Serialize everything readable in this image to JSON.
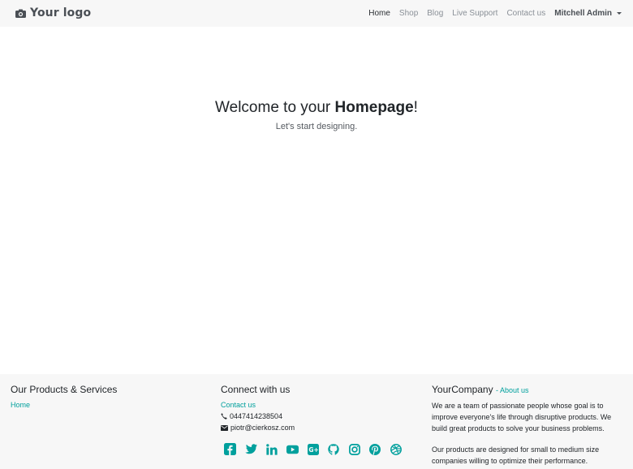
{
  "brand": {
    "logo_text": "Your logo",
    "icon": "camera-icon"
  },
  "nav": {
    "items": [
      "Home",
      "Shop",
      "Blog",
      "Live Support",
      "Contact us"
    ],
    "active": "Home",
    "user": "Mitchell Admin"
  },
  "hero": {
    "title_prefix": "Welcome to your ",
    "title_bold": "Homepage",
    "title_suffix": "!",
    "subtitle": "Let's start designing."
  },
  "footer": {
    "products": {
      "title": "Our Products & Services",
      "links": [
        "Home"
      ]
    },
    "connect": {
      "title": "Connect with us",
      "contact_link": "Contact us",
      "phone": "0447414238504",
      "email": "piotr@cierkosz.com",
      "socials": [
        "facebook-icon",
        "twitter-icon",
        "linkedin-icon",
        "youtube-icon",
        "google-plus-icon",
        "github-icon",
        "instagram-icon",
        "pinterest-icon",
        "dribbble-icon"
      ]
    },
    "company": {
      "title": "YourCompany",
      "about_link": "- About us",
      "paragraph1": "We are a team of passionate people whose goal is to improve everyone's life through disruptive products. We build great products to solve your business problems.",
      "paragraph2": "Our products are designed for small to medium size companies willing to optimize their performance."
    }
  },
  "colors": {
    "accent": "#00a09d",
    "navbar_bg": "#f7f7f7",
    "footer_bg": "#f7f7f7"
  }
}
